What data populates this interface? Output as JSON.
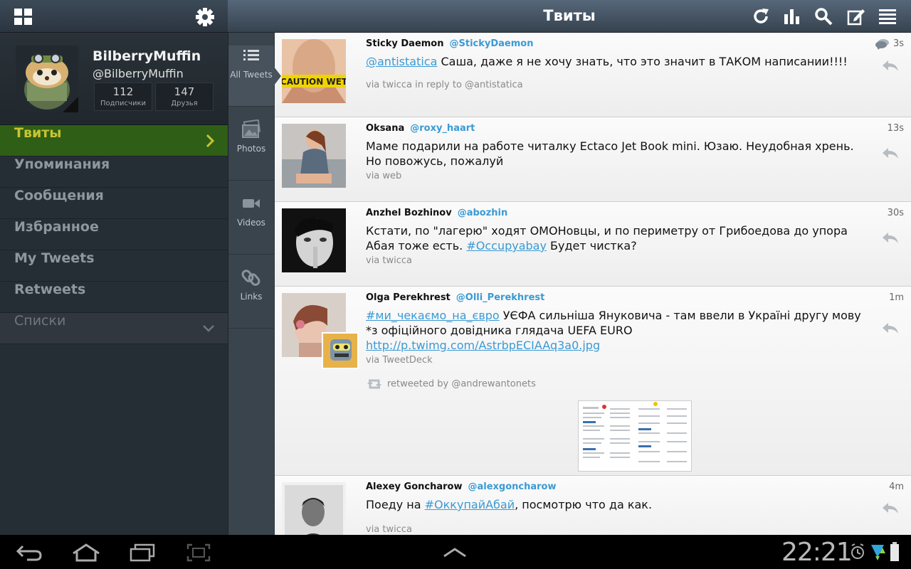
{
  "header": {
    "title": "Твиты"
  },
  "profile": {
    "username": "BilberryMuffin",
    "handle": "@BilberryMuffin",
    "stats": [
      {
        "value": "112",
        "label": "Подписчики"
      },
      {
        "value": "147",
        "label": "Друзья"
      }
    ]
  },
  "nav": [
    {
      "label": "Твиты"
    },
    {
      "label": "Упоминания"
    },
    {
      "label": "Сообщения"
    },
    {
      "label": "Избранное"
    },
    {
      "label": "My Tweets"
    },
    {
      "label": "Retweets"
    },
    {
      "label": "Списки"
    }
  ],
  "filters": [
    {
      "label": "All Tweets"
    },
    {
      "label": "Photos"
    },
    {
      "label": "Videos"
    },
    {
      "label": "Links"
    }
  ],
  "tweets": [
    {
      "author": "Sticky Daemon",
      "handle": "@StickyDaemon",
      "time": "3s",
      "mention": "@antistatica",
      "text": " Саша, даже я не хочу знать, что это значит в ТАКОМ написании!!!!",
      "via": "via twicca in reply to @antistatica",
      "avatar_caption": "CAUTION WET"
    },
    {
      "author": "Oksana",
      "handle": "@roxy_haart",
      "time": "13s",
      "text": "Маме подарили на работе читалку Ectaco Jet Book mini. Юзаю. Неудобная хрень. Но повожусь, пожалуй",
      "via": "via web"
    },
    {
      "author": "Anzhel Bozhinov",
      "handle": "@abozhin",
      "time": "30s",
      "text_a": "Кстати, по \"лагерю\" ходят ОМОНовцы, и по периметру от Грибоедова до упора Абая тоже есть. ",
      "hashtag": "#Occupyabay",
      "text_b": " Будет чистка?",
      "via": "via twicca"
    },
    {
      "author": "Olga Perekhrest",
      "handle": "@Olli_Perekhrest",
      "time": "1m",
      "hashtag": "#ми_чекаємо_на_євро",
      "text": " УЄФА сильніша Януковича - там ввели в Україні другу мову *з офіційного довідника глядача UEFA EURO ",
      "link": "http://p.twimg.com/AstrbpECIAAq3a0.jpg",
      "via": "via TweetDeck",
      "retweeted_by": "retweeted by @andrewantonets"
    },
    {
      "author": "Alexey Goncharow",
      "handle": "@alexgoncharow",
      "time": "4m",
      "text_a": "Поеду на ",
      "hashtag": "#ОккупайАбай",
      "text_b": ", посмотрю что да как.",
      "via": "via twicca"
    }
  ],
  "status_bar": {
    "time": "22:21"
  }
}
